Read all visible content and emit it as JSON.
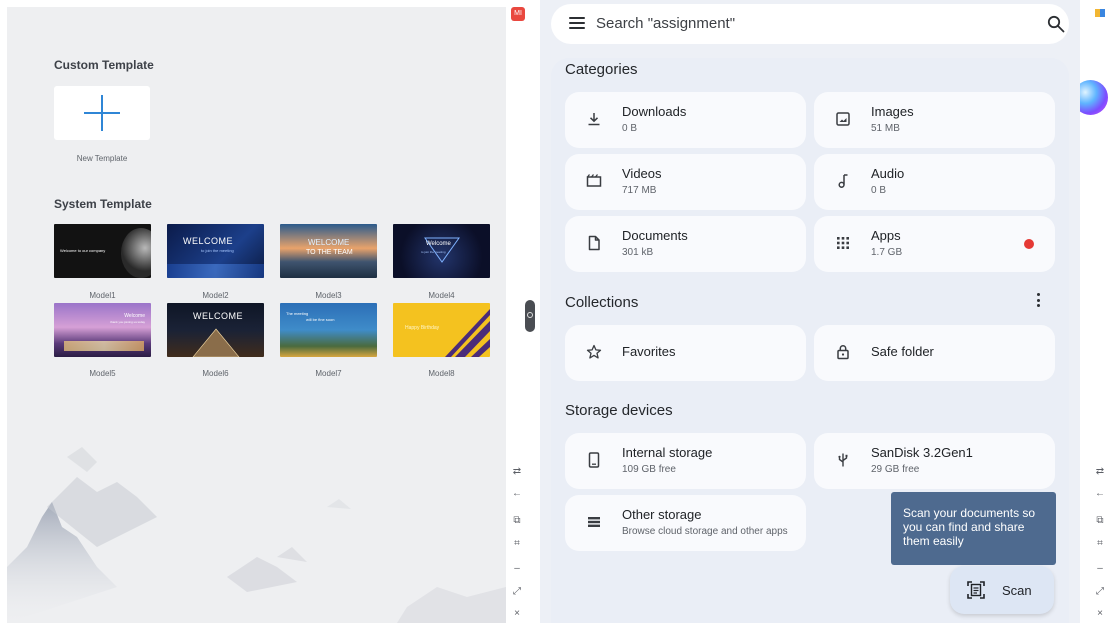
{
  "left": {
    "custom_heading": "Custom Template",
    "new_template_label": "New Template",
    "system_heading": "System Template",
    "models": [
      {
        "label": "Model1",
        "text": "Welcome to our company"
      },
      {
        "label": "Model2",
        "text": "WELCOME",
        "subtext": "to join the meeting"
      },
      {
        "label": "Model3",
        "text": "WELCOME",
        "subtext": "TO THE TEAM"
      },
      {
        "label": "Model4",
        "text": "Welcome",
        "subtext": "to join the meeting"
      },
      {
        "label": "Model5",
        "text": "Welcome",
        "subtext": "thank you joining us today"
      },
      {
        "label": "Model6",
        "text": "WELCOME"
      },
      {
        "label": "Model7",
        "text": "The meeting",
        "subtext": "will be fine soon"
      },
      {
        "label": "Model8",
        "text": "Happy Birthday"
      }
    ]
  },
  "badge": "MI",
  "search": {
    "placeholder": "Search \"assignment\""
  },
  "categories": {
    "title": "Categories",
    "items": [
      {
        "name": "Downloads",
        "sub": "0 B",
        "icon": "download-icon"
      },
      {
        "name": "Images",
        "sub": "51 MB",
        "icon": "image-icon"
      },
      {
        "name": "Videos",
        "sub": "717 MB",
        "icon": "video-icon"
      },
      {
        "name": "Audio",
        "sub": "0 B",
        "icon": "music-note-icon"
      },
      {
        "name": "Documents",
        "sub": "301 kB",
        "icon": "document-icon"
      },
      {
        "name": "Apps",
        "sub": "1.7 GB",
        "icon": "apps-grid-icon"
      }
    ]
  },
  "collections": {
    "title": "Collections",
    "items": [
      {
        "name": "Favorites",
        "icon": "star-icon"
      },
      {
        "name": "Safe folder",
        "icon": "lock-icon"
      }
    ]
  },
  "storage": {
    "title": "Storage devices",
    "items": [
      {
        "name": "Internal storage",
        "sub": "109 GB free",
        "icon": "phone-icon"
      },
      {
        "name": "SanDisk 3.2Gen1",
        "sub": "29 GB free",
        "icon": "usb-icon"
      },
      {
        "name": "Other storage",
        "sub": "Browse cloud storage and other apps",
        "icon": "storage-list-icon"
      }
    ]
  },
  "tooltip": "Scan your documents so you can find and share them easily",
  "scan": {
    "label": "Scan"
  },
  "colors": {
    "accent": "#2f86d6",
    "tooltip": "#4e6a8f",
    "alert_dot": "#e53935",
    "panel": "#eaeef6"
  },
  "strip_icons": [
    "swap-icon",
    "back-arrow-icon",
    "screenshot-icon",
    "crop-icon",
    "minimize-icon",
    "expand-icon",
    "close-icon"
  ]
}
